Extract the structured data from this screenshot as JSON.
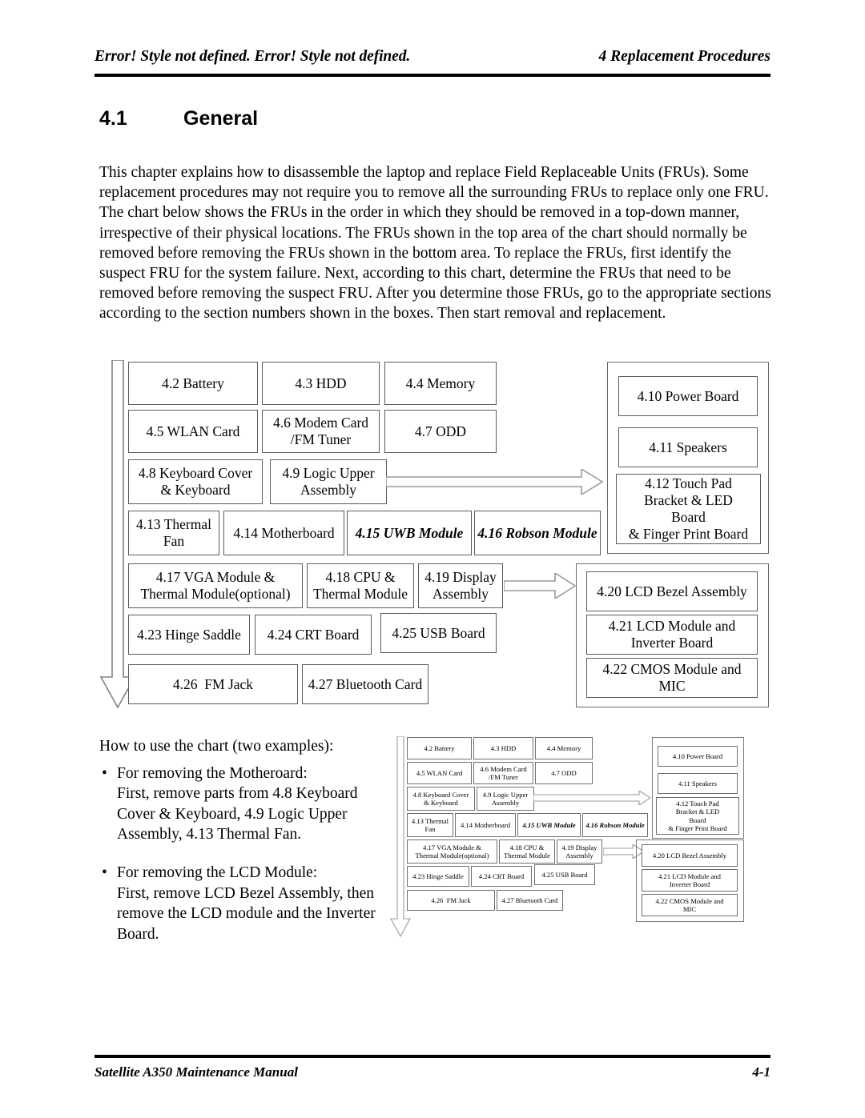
{
  "header": {
    "left": "Error! Style not defined. Error! Style not defined.",
    "right": "4 Replacement Procedures"
  },
  "section": {
    "number": "4.1",
    "title": "General"
  },
  "body": {
    "paragraph": "This chapter explains how to disassemble the laptop and replace Field Replaceable Units (FRUs). Some replacement procedures may not require you to remove all the surrounding FRUs to replace only one FRU. The chart below shows the FRUs in the order in which they should be removed in a top-down manner, irrespective of their physical locations. The FRUs shown in the top area of the chart should normally be removed before removing the FRUs shown in the bottom area. To replace the FRUs, first identify the suspect FRU for the system failure. Next, according to this chart, determine the FRUs that need to be removed before removing the suspect FRU. After you determine those FRUs, go to the appropriate sections according to the section numbers shown in the boxes. Then start removal and replacement."
  },
  "chart_data": {
    "type": "diagram",
    "title": "FRU removal order chart",
    "boxes": {
      "b42": "4.2 Battery",
      "b43": "4.3 HDD",
      "b44": "4.4 Memory",
      "b45": "4.5 WLAN Card",
      "b46": "4.6 Modem Card\n/FM Tuner",
      "b47": "4.7 ODD",
      "b48": "4.8 Keyboard Cover\n& Keyboard",
      "b49": "4.9 Logic Upper\nAssembly",
      "b410": "4.10 Power Board",
      "b411": "4.11 Speakers",
      "b412": "4.12 Touch Pad\nBracket & LED\nBoard\n& Finger Print Board",
      "b413": "4.13 Thermal\nFan",
      "b414": "4.14 Motherboard",
      "b415": "4.15 UWB Module",
      "b416": "4.16 Robson Module",
      "b417": "4.17 VGA Module &\nThermal Module(optional)",
      "b418": "4.18 CPU &\nThermal Module",
      "b419": "4.19 Display\nAssembly",
      "b420": "4.20 LCD Bezel Assembly",
      "b421": "4.21 LCD Module and\nInverter Board",
      "b422": "4.22 CMOS Module and\nMIC",
      "b423": "4.23 Hinge Saddle",
      "b424": "4.24 CRT Board",
      "b425": "4.25 USB Board",
      "b426": "4.26  FM Jack",
      "b427": "4.27 Bluetooth Card"
    },
    "italic_boxes": [
      "b415",
      "b416"
    ],
    "arrows": [
      {
        "name": "top-down-order-arrow",
        "direction": "down"
      },
      {
        "name": "logic-upper-to-power-board-arrow",
        "direction": "right"
      },
      {
        "name": "display-assembly-to-lcd-bezel-arrow",
        "direction": "right"
      }
    ],
    "groups": [
      "upper-right-group",
      "lower-right-group"
    ]
  },
  "examples": {
    "lead": "How to use the chart (two examples):",
    "items": [
      {
        "bullet": "•",
        "title": "For removing the Motheroard:",
        "body": "First, remove parts from 4.8 Keyboard Cover & Keyboard, 4.9 Logic Upper Assembly, 4.13 Thermal Fan."
      },
      {
        "bullet": "•",
        "title": "For removing the LCD Module:",
        "body": "First, remove LCD Bezel Assembly, then remove the LCD module and the Inverter Board."
      }
    ]
  },
  "footer": {
    "left": "Satellite A350 Maintenance Manual",
    "right": "4-1"
  },
  "colors": {
    "text": "#000000",
    "box_border": "#5b5b5b",
    "group_border": "#6a6a6a",
    "page_background": "#ffffff"
  }
}
